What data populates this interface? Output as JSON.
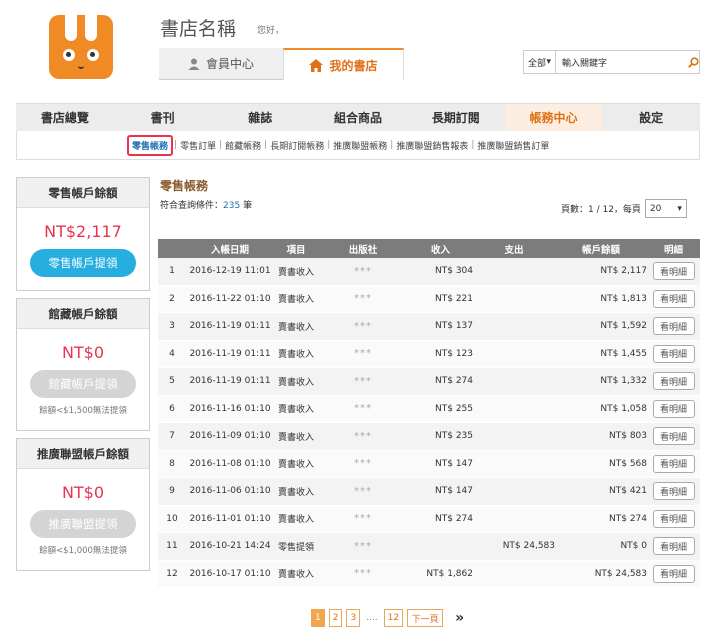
{
  "header": {
    "store_name": "書店名稱",
    "greeting": "您好，",
    "tabs": [
      {
        "label": "會員中心",
        "icon": "user-icon"
      },
      {
        "label": "我的書店",
        "icon": "home-icon"
      }
    ],
    "search": {
      "scope": "全部",
      "value": "輸入關鍵字"
    }
  },
  "main_nav": [
    "書店總覽",
    "書刊",
    "雜誌",
    "組合商品",
    "長期訂閱",
    "帳務中心",
    "設定"
  ],
  "sub_nav": [
    "零售帳務",
    "零售訂單",
    "館藏帳務",
    "長期訂閱帳務",
    "推廣聯盟帳務",
    "推廣聯盟銷售報表",
    "推廣聯盟銷售訂單"
  ],
  "sidebar": [
    {
      "title": "零售帳戶餘額",
      "amount": "NT$2,117",
      "button": "零售帳戶提領",
      "note": ""
    },
    {
      "title": "館藏帳戶餘額",
      "amount": "NT$0",
      "button": "館藏帳戶提領",
      "note": "餘額<$1,500無法提領"
    },
    {
      "title": "推廣聯盟帳戶餘額",
      "amount": "NT$0",
      "button": "推廣聯盟提領",
      "note": "餘額<$1,000無法提領"
    }
  ],
  "content": {
    "title": "零售帳務",
    "match_prefix": "符合查詢條件：",
    "match_count": "235",
    "match_suffix": " 筆",
    "pages_label": "頁數：1 / 12，每頁",
    "per_page": "20",
    "columns": [
      "",
      "入帳日期",
      "項目",
      "出版社",
      "收入",
      "支出",
      "帳戶餘額",
      "明細"
    ],
    "detail_label": "看明細",
    "rows": [
      {
        "no": "1",
        "date": "2016-12-19 11:01",
        "item": "賣書收入",
        "publisher": "***",
        "income": "NT$ 304",
        "expense": "",
        "balance": "NT$ 2,117"
      },
      {
        "no": "2",
        "date": "2016-11-22 01:10",
        "item": "賣書收入",
        "publisher": "***",
        "income": "NT$ 221",
        "expense": "",
        "balance": "NT$ 1,813"
      },
      {
        "no": "3",
        "date": "2016-11-19 01:11",
        "item": "賣書收入",
        "publisher": "***",
        "income": "NT$ 137",
        "expense": "",
        "balance": "NT$ 1,592"
      },
      {
        "no": "4",
        "date": "2016-11-19 01:11",
        "item": "賣書收入",
        "publisher": "***",
        "income": "NT$ 123",
        "expense": "",
        "balance": "NT$ 1,455"
      },
      {
        "no": "5",
        "date": "2016-11-19 01:11",
        "item": "賣書收入",
        "publisher": "***",
        "income": "NT$ 274",
        "expense": "",
        "balance": "NT$ 1,332"
      },
      {
        "no": "6",
        "date": "2016-11-16 01:10",
        "item": "賣書收入",
        "publisher": "***",
        "income": "NT$ 255",
        "expense": "",
        "balance": "NT$ 1,058"
      },
      {
        "no": "7",
        "date": "2016-11-09 01:10",
        "item": "賣書收入",
        "publisher": "***",
        "income": "NT$ 235",
        "expense": "",
        "balance": "NT$ 803"
      },
      {
        "no": "8",
        "date": "2016-11-08 01:10",
        "item": "賣書收入",
        "publisher": "***",
        "income": "NT$ 147",
        "expense": "",
        "balance": "NT$ 568"
      },
      {
        "no": "9",
        "date": "2016-11-06 01:10",
        "item": "賣書收入",
        "publisher": "***",
        "income": "NT$ 147",
        "expense": "",
        "balance": "NT$ 421"
      },
      {
        "no": "10",
        "date": "2016-11-01 01:10",
        "item": "賣書收入",
        "publisher": "***",
        "income": "NT$ 274",
        "expense": "",
        "balance": "NT$ 274"
      },
      {
        "no": "11",
        "date": "2016-10-21 14:24",
        "item": "零售提領",
        "publisher": "***",
        "income": "",
        "expense": "NT$ 24,583",
        "balance": "NT$ 0"
      },
      {
        "no": "12",
        "date": "2016-10-17 01:10",
        "item": "賣書收入",
        "publisher": "***",
        "income": "NT$ 1,862",
        "expense": "",
        "balance": "NT$ 24,583"
      }
    ]
  },
  "pagination": {
    "pages": [
      "1",
      "2",
      "3"
    ],
    "dots": "....",
    "last": "12",
    "next": "下一頁",
    "end": "»"
  },
  "colors": {
    "accent": "#f08a24",
    "active_text": "#e07216",
    "amount": "#e8344e",
    "button": "#27aee0"
  }
}
